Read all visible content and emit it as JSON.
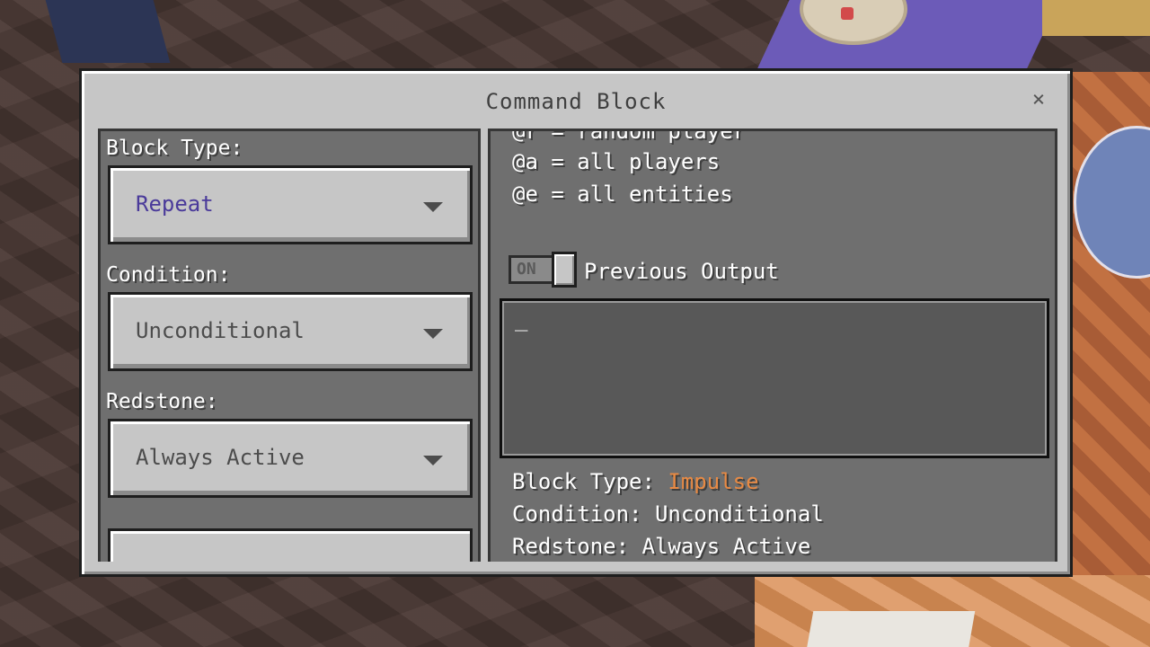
{
  "dialog": {
    "title": "Command Block",
    "close_symbol": "×"
  },
  "left": {
    "block_type_label": "Block Type:",
    "block_type_value": "Repeat",
    "condition_label": "Condition:",
    "condition_value": "Unconditional",
    "redstone_label": "Redstone:",
    "redstone_value": "Always Active"
  },
  "right": {
    "help_lines": [
      "@r = random player",
      "@a = all players",
      "@e = all entities"
    ],
    "toggle_state": "ON",
    "toggle_label": "Previous Output",
    "output_cursor": "_",
    "summary": {
      "block_type_label": "Block Type: ",
      "block_type_value": "Impulse",
      "condition_text": "Condition: Unconditional",
      "redstone_text": "Redstone: Always Active"
    }
  },
  "colors": {
    "accent_value": "#4a3a9a",
    "highlight": "#e88a44",
    "panel": "#6f6f6f",
    "dialog": "#c6c6c6"
  }
}
